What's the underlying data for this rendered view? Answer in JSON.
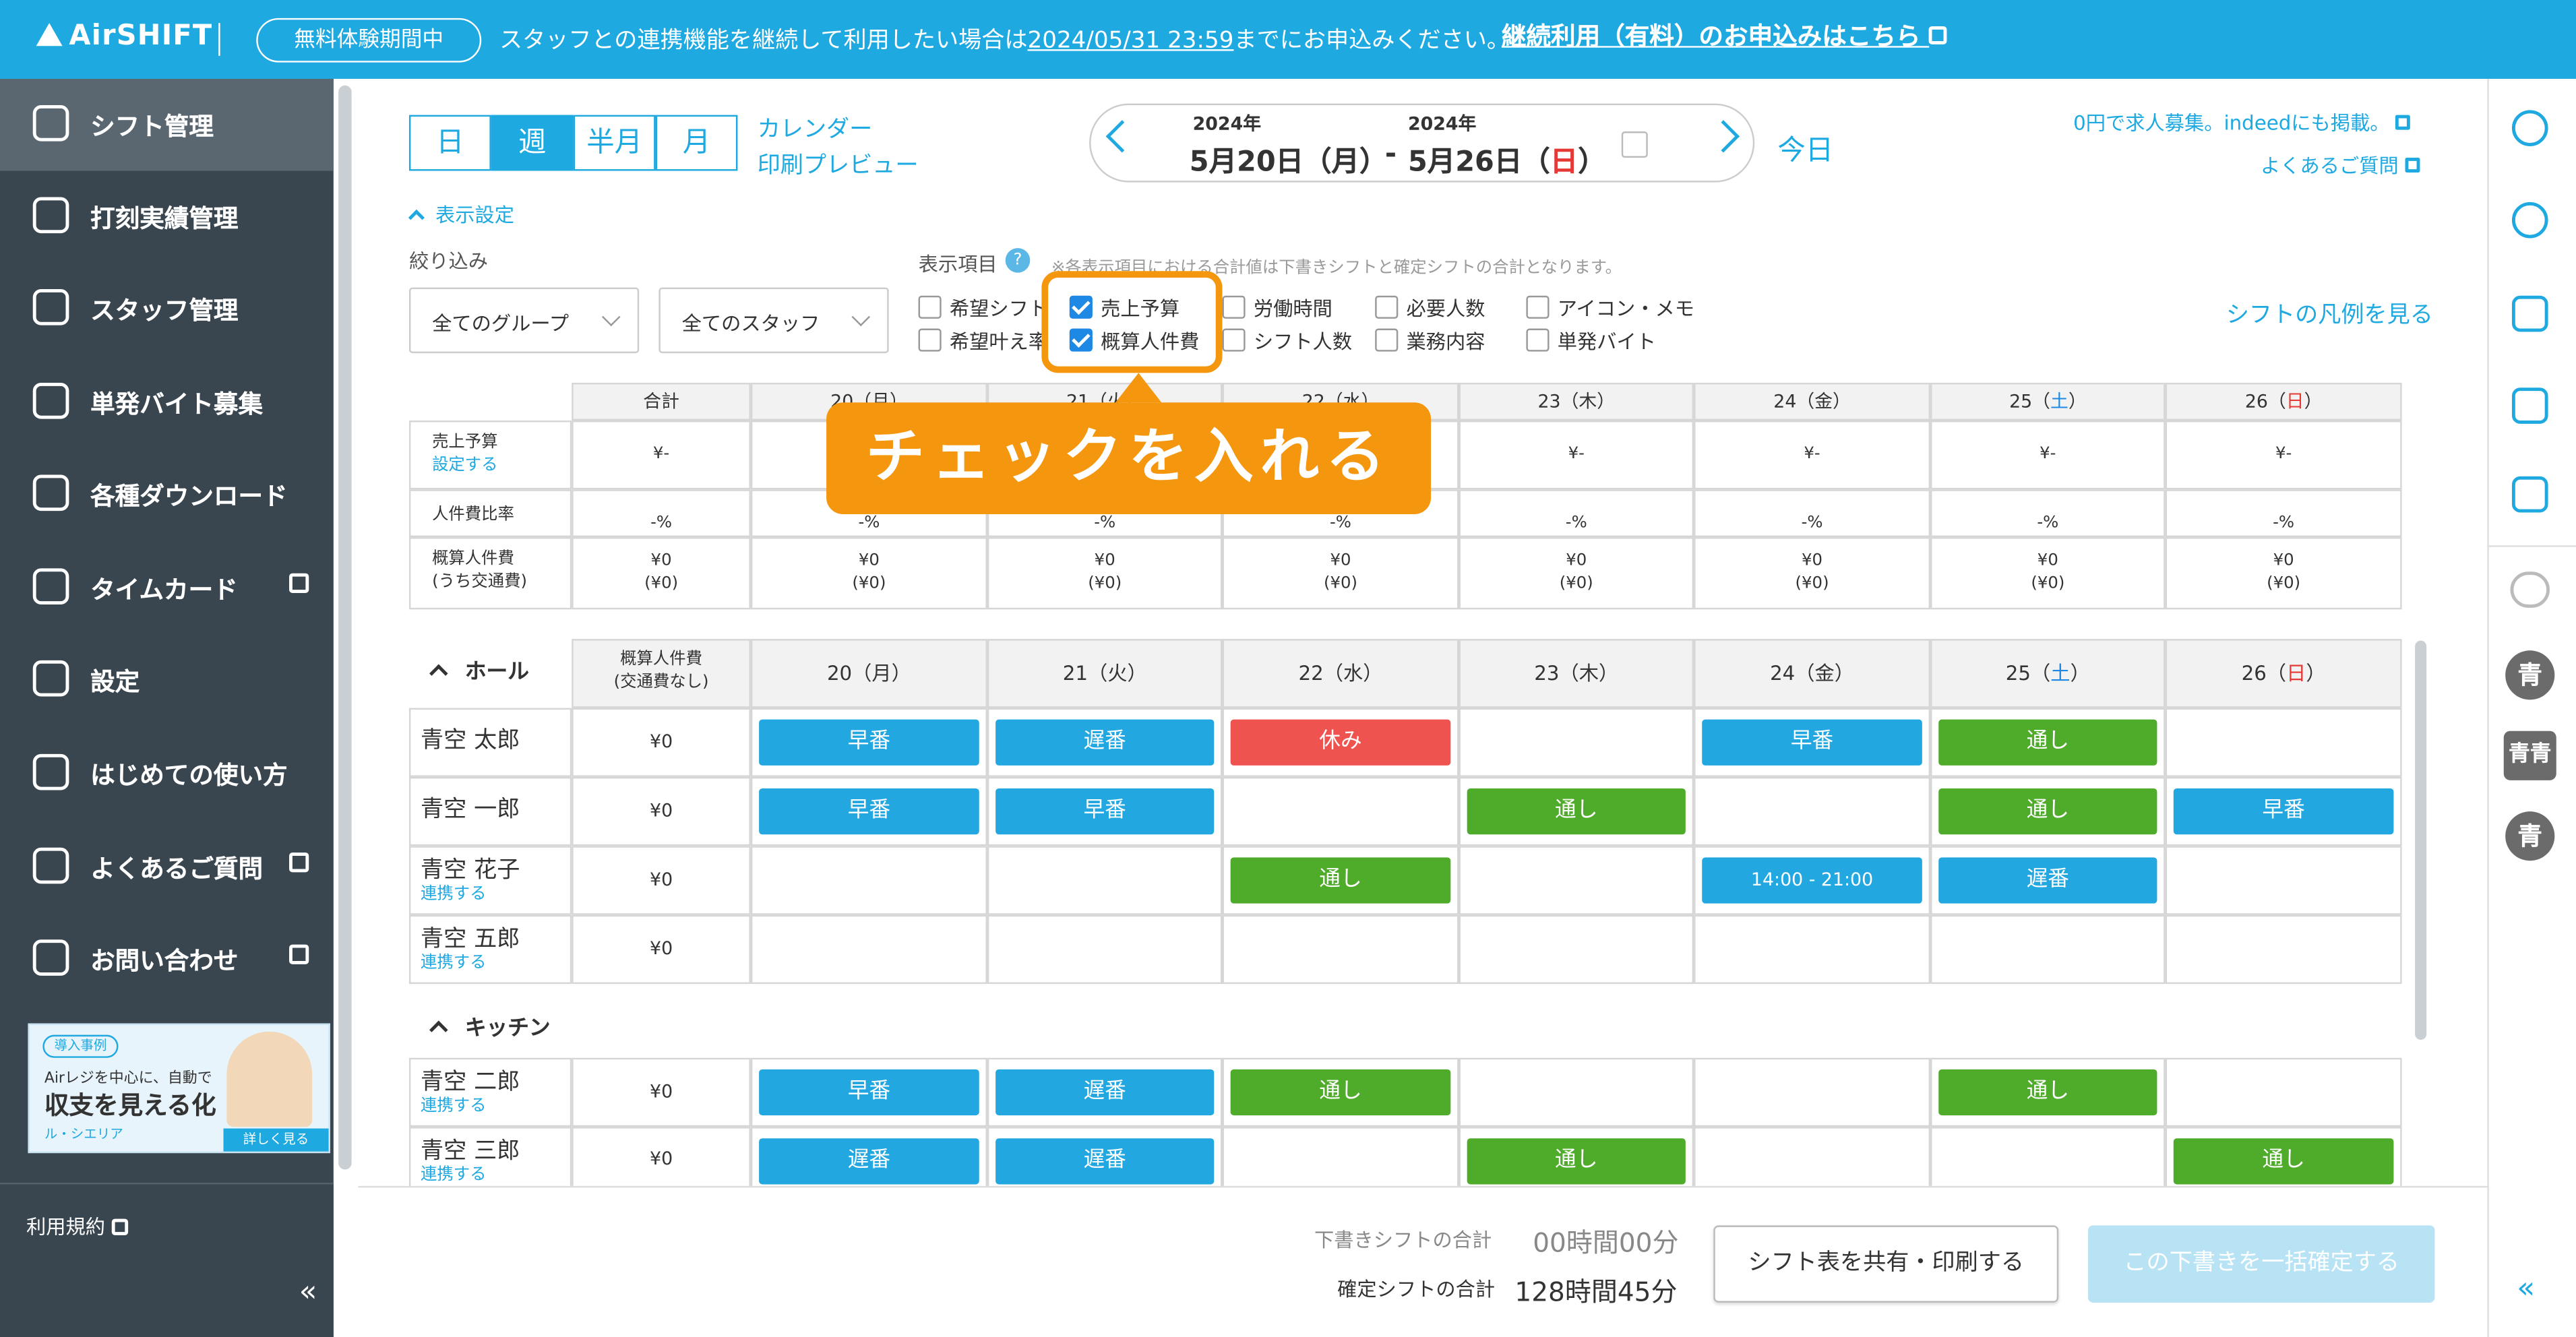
{
  "banner": {
    "logo": "AirSHIFT",
    "trial_badge": "無料体験期間中",
    "msg_pre": "スタッフとの連携機能を継続して利用したい場合は",
    "deadline": "2024/05/31 23:59",
    "msg_post": "までにお申込みください。",
    "cta": "継続利用（有料）のお申込みはこちら"
  },
  "sidebar": {
    "items": [
      {
        "label": "シフト管理"
      },
      {
        "label": "打刻実績管理"
      },
      {
        "label": "スタッフ管理"
      },
      {
        "label": "単発バイト募集"
      },
      {
        "label": "各種ダウンロード"
      },
      {
        "label": "タイムカード"
      },
      {
        "label": "設定"
      },
      {
        "label": "はじめての使い方"
      },
      {
        "label": "よくあるご質問"
      },
      {
        "label": "お問い合わせ"
      }
    ],
    "promo": {
      "tag": "導入事例",
      "line1": "Airレジを中心に、自動で",
      "line2": "収支を見える化",
      "line3": "ル・シエリア",
      "more": "詳しく見る"
    },
    "terms": "利用規約",
    "collapse": "«"
  },
  "toolbar": {
    "views": [
      "日",
      "週",
      "半月",
      "月"
    ],
    "calendar_preview_1": "カレンダー",
    "calendar_preview_2": "印刷プレビュー",
    "year1": "2024年",
    "year2": "2024年",
    "date_from": "5月20日（月）",
    "dash": "-",
    "date_to_pre": "5月26日（",
    "date_to_day": "日",
    "date_to_post": "）",
    "today": "今日",
    "indeed": "0円で求人募集。indeedにも掲載。",
    "faq": "よくあるご質問"
  },
  "display": {
    "toggle": "表示設定",
    "filter_label": "絞り込み",
    "group_select": "全てのグループ",
    "staff_select": "全てのスタッフ",
    "items_label": "表示項目",
    "note": "※各表示項目における合計値は下書きシフトと確定シフトの合計となります。",
    "checks": [
      {
        "label": "希望シフト",
        "on": false
      },
      {
        "label": "希望叶え率",
        "on": false
      },
      {
        "label": "売上予算",
        "on": true
      },
      {
        "label": "概算人件費",
        "on": true
      },
      {
        "label": "労働時間",
        "on": false
      },
      {
        "label": "シフト人数",
        "on": false
      },
      {
        "label": "必要人数",
        "on": false
      },
      {
        "label": "業務内容",
        "on": false
      },
      {
        "label": "アイコン・メモ",
        "on": false
      },
      {
        "label": "単発バイト",
        "on": false
      }
    ],
    "legend_link": "シフトの凡例を見る"
  },
  "callout": "チェックを入れる",
  "summary": {
    "header": [
      "合計",
      "20（月）",
      "21（火）",
      "22（水）",
      "23（木）",
      "24（金）",
      "25（土）",
      "26（日）"
    ],
    "rows": [
      {
        "label": "売上予算",
        "sub": "設定する",
        "vals": [
          "¥-",
          "¥-",
          "¥-",
          "¥-",
          "¥-",
          "¥-",
          "¥-",
          "¥-"
        ]
      },
      {
        "label": "人件費比率",
        "sub": "",
        "vals": [
          "-%",
          "-%",
          "-%",
          "-%",
          "-%",
          "-%",
          "-%",
          "-%"
        ]
      },
      {
        "label": "概算人件費",
        "sub": "(うち交通費)",
        "vals": [
          "¥0",
          "¥0",
          "¥0",
          "¥0",
          "¥0",
          "¥0",
          "¥0",
          "¥0"
        ],
        "vals2": [
          "(¥0)",
          "(¥0)",
          "(¥0)",
          "(¥0)",
          "(¥0)",
          "(¥0)",
          "(¥0)",
          "(¥0)"
        ]
      }
    ]
  },
  "shifts": {
    "cost_header_1": "概算人件費",
    "cost_header_2": "(交通費なし)",
    "days": [
      "20（月）",
      "21（火）",
      "22（水）",
      "23（木）",
      "24（金）",
      "25（土）",
      "26（日）"
    ],
    "groups": [
      {
        "name": "ホール",
        "staff": [
          {
            "name": "青空 太郎",
            "link": "",
            "cost": "¥0",
            "shifts": [
              [
                "早番",
                "blue"
              ],
              [
                "遅番",
                "blue"
              ],
              [
                "休み",
                "red"
              ],
              null,
              [
                "早番",
                "blue"
              ],
              [
                "通し",
                "green"
              ],
              null
            ]
          },
          {
            "name": "青空 一郎",
            "link": "",
            "cost": "¥0",
            "shifts": [
              [
                "早番",
                "blue"
              ],
              [
                "早番",
                "blue"
              ],
              null,
              [
                "通し",
                "green"
              ],
              null,
              [
                "通し",
                "green"
              ],
              [
                "早番",
                "blue"
              ]
            ]
          },
          {
            "name": "青空 花子",
            "link": "連携する",
            "cost": "¥0",
            "shifts": [
              null,
              null,
              [
                "通し",
                "green"
              ],
              null,
              [
                "14:00 - 21:00",
                "blue"
              ],
              [
                "遅番",
                "blue"
              ],
              null
            ]
          },
          {
            "name": "青空 五郎",
            "link": "連携する",
            "cost": "¥0",
            "shifts": [
              null,
              null,
              null,
              null,
              null,
              null,
              null
            ]
          }
        ]
      },
      {
        "name": "キッチン",
        "staff": [
          {
            "name": "青空 二郎",
            "link": "連携する",
            "cost": "¥0",
            "shifts": [
              [
                "早番",
                "blue"
              ],
              [
                "遅番",
                "blue"
              ],
              [
                "通し",
                "green"
              ],
              null,
              null,
              [
                "通し",
                "green"
              ],
              null
            ]
          },
          {
            "name": "青空 三郎",
            "link": "連携する",
            "cost": "¥0",
            "shifts": [
              [
                "遅番",
                "blue"
              ],
              [
                "遅番",
                "blue"
              ],
              null,
              [
                "通し",
                "green"
              ],
              null,
              null,
              [
                "通し",
                "green"
              ]
            ]
          }
        ]
      }
    ]
  },
  "footer": {
    "draft_label": "下書きシフトの合計",
    "draft_value": "00時間00分",
    "fixed_label": "確定シフトの合計",
    "fixed_value": "128時間45分",
    "share_btn": "シフト表を共有・印刷する",
    "confirm_btn": "この下書きを一括確定する"
  },
  "rightrail": {
    "avatars": [
      "青",
      "青青",
      "青"
    ],
    "collapse": "«"
  },
  "colors": {
    "accent": "#1fa9e1",
    "sidebar": "#3a464f",
    "callout": "#f5960f",
    "early": "#22a7e0",
    "full": "#4fab2a",
    "off": "#ef5350"
  }
}
